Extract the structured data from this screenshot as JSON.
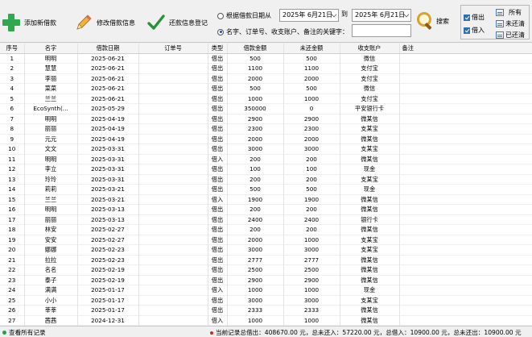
{
  "toolbar": {
    "add_label": "添加新借款",
    "edit_label": "修改借款信息",
    "repay_label": "还款信息登记",
    "search_label": "搜索"
  },
  "filter": {
    "by_date_label": "根据借款日期从",
    "date_from": "2025年 6月21日",
    "to_label": "到",
    "date_to": "2025年 6月21日",
    "by_keyword_label": "名字、订单号、收支账户、备注的关键字：",
    "keyword_value": ""
  },
  "type_filter": {
    "borrow_out": "借出",
    "borrow_in": "借入",
    "all": "所有",
    "not_repaid": "未还清",
    "repaid": "已还清"
  },
  "table": {
    "columns": [
      "序号",
      "名字",
      "借款日期",
      "订单号",
      "类型",
      "借款金额",
      "未还金额",
      "收支账户",
      "备注"
    ],
    "rows": [
      [
        "1",
        "明明",
        "2025-06-21",
        "",
        "借出",
        "500",
        "500",
        "微信",
        ""
      ],
      [
        "2",
        "慧慧",
        "2025-06-21",
        "",
        "借出",
        "1100",
        "1100",
        "支付宝",
        ""
      ],
      [
        "3",
        "李丽",
        "2025-06-21",
        "",
        "借出",
        "2000",
        "2000",
        "支付宝",
        ""
      ],
      [
        "4",
        "菜菜",
        "2025-06-21",
        "",
        "借出",
        "500",
        "500",
        "微信",
        ""
      ],
      [
        "5",
        "兰兰",
        "2025-06-21",
        "",
        "借出",
        "1000",
        "1000",
        "支付宝",
        ""
      ],
      [
        "6",
        "EcoSynth(...",
        "2025-05-29",
        "",
        "借出",
        "350000",
        "0",
        "平安银行卡",
        ""
      ],
      [
        "7",
        "明明",
        "2025-04-19",
        "",
        "借出",
        "2900",
        "2900",
        "微某信",
        ""
      ],
      [
        "8",
        "丽丽",
        "2025-04-19",
        "",
        "借出",
        "2300",
        "2300",
        "支某宝",
        ""
      ],
      [
        "9",
        "元元",
        "2025-04-19",
        "",
        "借出",
        "2000",
        "2000",
        "微某信",
        ""
      ],
      [
        "10",
        "文文",
        "2025-03-31",
        "",
        "借出",
        "3000",
        "3000",
        "支某宝",
        ""
      ],
      [
        "11",
        "明明",
        "2025-03-31",
        "",
        "借入",
        "200",
        "200",
        "微某信",
        ""
      ],
      [
        "12",
        "李立",
        "2025-03-31",
        "",
        "借出",
        "100",
        "100",
        "现金",
        ""
      ],
      [
        "13",
        "玲玲",
        "2025-03-31",
        "",
        "借出",
        "200",
        "200",
        "支某宝",
        ""
      ],
      [
        "14",
        "莉莉",
        "2025-03-21",
        "",
        "借出",
        "500",
        "500",
        "现金",
        ""
      ],
      [
        "15",
        "兰兰",
        "2025-03-21",
        "",
        "借入",
        "1900",
        "1900",
        "微某信",
        ""
      ],
      [
        "16",
        "明明",
        "2025-03-13",
        "",
        "借出",
        "200",
        "200",
        "微某信",
        ""
      ],
      [
        "17",
        "丽丽",
        "2025-03-13",
        "",
        "借出",
        "2400",
        "2400",
        "银行卡",
        ""
      ],
      [
        "18",
        "林安",
        "2025-02-27",
        "",
        "借出",
        "200",
        "200",
        "微某信",
        ""
      ],
      [
        "19",
        "安安",
        "2025-02-27",
        "",
        "借出",
        "2000",
        "1000",
        "支某宝",
        ""
      ],
      [
        "20",
        "娜娜",
        "2025-02-23",
        "",
        "借出",
        "3000",
        "3000",
        "支某宝",
        ""
      ],
      [
        "21",
        "拉拉",
        "2025-02-23",
        "",
        "借出",
        "2777",
        "2777",
        "微某信",
        ""
      ],
      [
        "22",
        "名名",
        "2025-02-19",
        "",
        "借出",
        "2500",
        "2500",
        "微某信",
        ""
      ],
      [
        "23",
        "泰子",
        "2025-02-19",
        "",
        "借出",
        "2900",
        "2900",
        "微某信",
        ""
      ],
      [
        "24",
        "满满",
        "2025-01-17",
        "",
        "借入",
        "1000",
        "1000",
        "现金",
        ""
      ],
      [
        "25",
        "小小",
        "2025-01-17",
        "",
        "借出",
        "3000",
        "3000",
        "支某宝",
        ""
      ],
      [
        "26",
        "莘莘",
        "2025-01-17",
        "",
        "借出",
        "2333",
        "2333",
        "微某信",
        ""
      ],
      [
        "27",
        "茜茜",
        "2024-12-31",
        "",
        "借入",
        "1000",
        "1000",
        "微某信",
        ""
      ]
    ]
  },
  "status": {
    "view_all": "查看所有记录",
    "summary": "当前记录总借出：408670.00 元，总未还入：57220.00 元，总借入：10900.00 元，总未还出：10900.00 元"
  },
  "colors": {
    "accent": "#2f6fba",
    "add_icon": "#2fa84f",
    "status_dot": "#1ea04a",
    "summary_dot": "#d0281f"
  }
}
